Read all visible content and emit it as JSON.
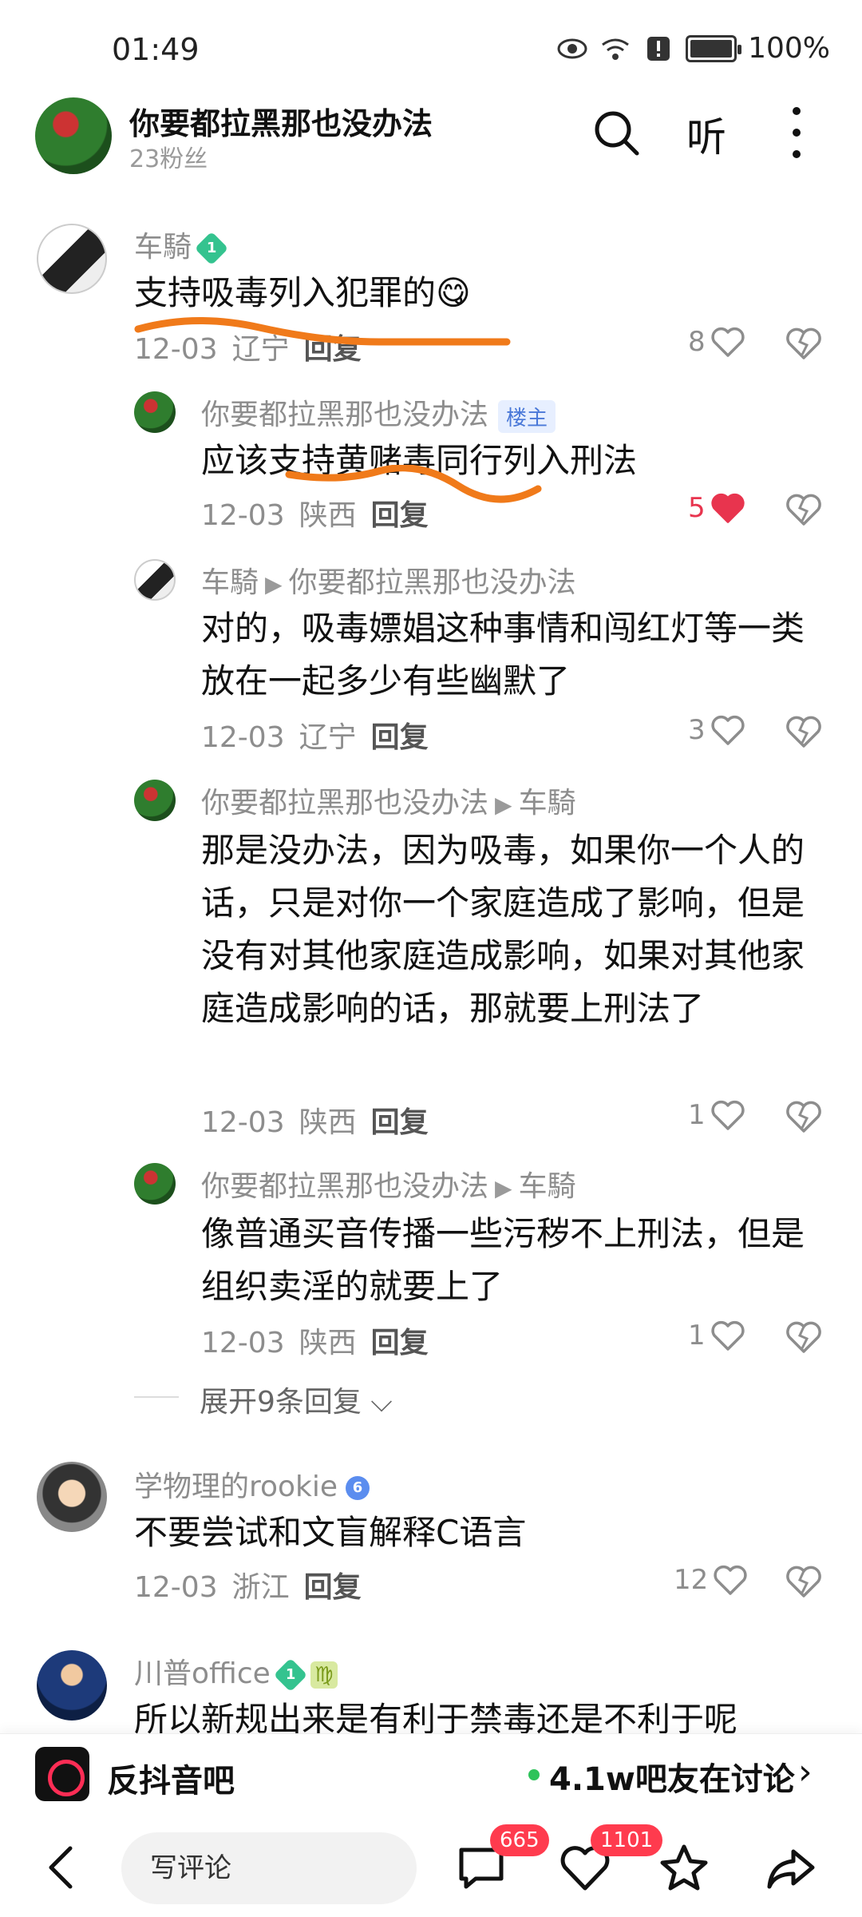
{
  "status": {
    "time": "01:49",
    "battery": "100%"
  },
  "header": {
    "title": "你要都拉黑那也没办法",
    "fans": "23粉丝",
    "listen": "听"
  },
  "comments": [
    {
      "user": "车騎",
      "level": "1",
      "text": "支持吸毒列入犯罪的😋",
      "date": "12-03",
      "loc": "辽宁",
      "reply": "回复",
      "likes": "8"
    },
    {
      "user": "你要都拉黑那也没办法",
      "tag": "楼主",
      "text": "应该支持黄赌毒同行列入刑法",
      "date": "12-03",
      "loc": "陕西",
      "reply": "回复",
      "likes": "5"
    },
    {
      "user": "车騎",
      "target": "你要都拉黑那也没办法",
      "text": "对的，吸毒嫖娼这种事情和闯红灯等一类放在一起多少有些幽默了",
      "date": "12-03",
      "loc": "辽宁",
      "reply": "回复",
      "likes": "3"
    },
    {
      "user": "你要都拉黑那也没办法",
      "target": "车騎",
      "text": "那是没办法，因为吸毒，如果你一个人的话，只是对你一个家庭造成了影响，但是没有对其他家庭造成影响，如果对其他家庭造成影响的话，那就要上刑法了",
      "date": "12-03",
      "loc": "陕西",
      "reply": "回复",
      "likes": "1"
    },
    {
      "user": "你要都拉黑那也没办法",
      "target": "车騎",
      "text": "像普通买音传播一些污秽不上刑法，但是组织卖淫的就要上了",
      "date": "12-03",
      "loc": "陕西",
      "reply": "回复",
      "likes": "1"
    },
    {
      "user": "学物理的rookie",
      "level": "6",
      "text": "不要尝试和文盲解释C语言",
      "date": "12-03",
      "loc": "浙江",
      "reply": "回复",
      "likes": "12"
    },
    {
      "user": "川普office",
      "level": "1",
      "zodiac": "♍",
      "text": "所以新规出来是有利于禁毒还是不利于呢"
    }
  ],
  "expand": "展开9条回复",
  "community": {
    "name": "反抖音吧",
    "discuss": "4.1w吧友在讨论"
  },
  "bottom": {
    "placeholder": "写评论",
    "comment_count": "665",
    "like_count": "1101"
  },
  "colors": {
    "accent_red": "#e8344e",
    "online_green": "#2ec35a",
    "highlight_orange": "#f07a1a"
  },
  "icons": [
    "eye-icon",
    "wifi-icon",
    "alert-icon",
    "battery-icon",
    "search-icon",
    "more-icon",
    "heart-icon",
    "dislike-heart-icon",
    "chevron-down-icon",
    "back-icon",
    "comment-icon",
    "star-icon",
    "share-icon"
  ]
}
